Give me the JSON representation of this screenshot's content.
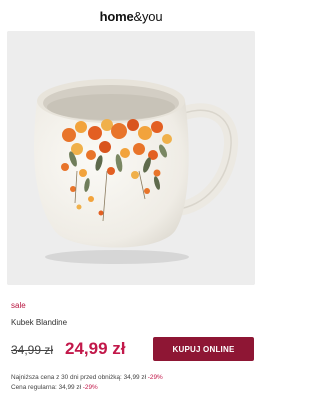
{
  "brand": {
    "part1": "home",
    "part2": "&you"
  },
  "product": {
    "tag": "sale",
    "name": "Kubek Blandine",
    "old_price": "34,99 zł",
    "price": "24,99 zł",
    "image_alt": ""
  },
  "buy_button": {
    "label": "KUPUJ ONLINE"
  },
  "info": {
    "lowest_text": "Najniższa cena z 30 dni przed obniżką: 34,99 zł",
    "lowest_pct": "-29%",
    "regular_text": "Cena regularna: 34,99 zł",
    "regular_pct": "-29%"
  },
  "colors": {
    "accent": "#c2184a",
    "button": "#8e1634",
    "image_bg": "#ededed"
  }
}
